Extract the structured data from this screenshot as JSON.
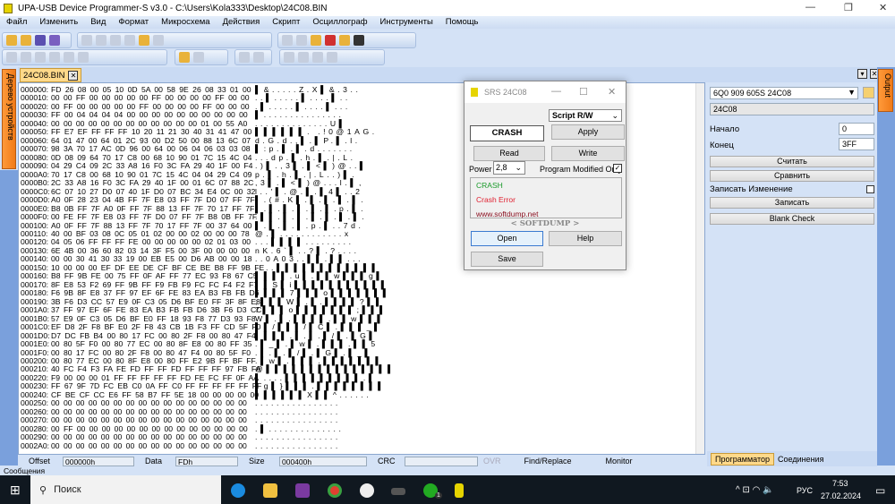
{
  "window": {
    "title": "UPA-USB Device Programmer-S v3.0 - C:\\Users\\Kola333\\Desktop\\24C08.BIN",
    "min": "—",
    "max": "❐",
    "close": "✕"
  },
  "menu": [
    "Файл",
    "Изменить",
    "Вид",
    "Формат",
    "Микросхема",
    "Действия",
    "Скрипт",
    "Осциллограф",
    "Инструменты",
    "Помощь"
  ],
  "file_tab": "24C08.BIN",
  "left_tab": "Дерево устройств",
  "right_tab": "Output",
  "hex_rows": [
    [
      "000000:",
      "FD 26 08 00 05 10 0D 5A 00 58 9E 26 08 33 01 00"
    ],
    [
      "000010:",
      "00 00 FF 00 00 00 00 00 FF 00 00 00 00 FF 00 00"
    ],
    [
      "000020:",
      "00 FF 00 00 00 00 00 FF 00 00 00 00 FF 00 00 00"
    ],
    [
      "000030:",
      "FF 00 04 04 04 04 00 00 00 00 00 00 00 00 00 00"
    ],
    [
      "000040:",
      "00 00 00 00 00 00 00 00 00 00 00 00 01 00 55 A0"
    ],
    [
      "000050:",
      "FF E7 EF FF FF FF 10 20 11 21 30 40 31 41 47 00"
    ],
    [
      "000060:",
      "64 01 47 00 64 01 2C 93 00 D2 50 00 88 13 6C 07"
    ],
    [
      "000070:",
      "98 3A 70 17 AC 0D 96 00 64 00 06 04 06 03 03 08"
    ],
    [
      "000080:",
      "0D 08 09 64 70 17 C8 00 68 10 90 01 7C 15 4C 04"
    ],
    [
      "000090:",
      "04 29 C4 09 2C 33 A8 16 F0 3C FA 29 40 1F 00 F4"
    ],
    [
      "0000A0:",
      "70 17 C8 00 68 10 90 01 7C 15 4C 04 04 29 C4 09"
    ],
    [
      "0000B0:",
      "2C 33 A8 16 F0 3C FA 29 40 1F 00 01 6C 07 88 2C"
    ],
    [
      "0000C0:",
      "6C 07 10 27 D0 07 40 1F D0 07 BC 34 E4 0C 00 32"
    ],
    [
      "0000D0:",
      "A0 0F 28 23 04 4B FF 7F E8 03 FF 7F D0 07 FF 7F"
    ],
    [
      "0000E0:",
      "B8 0B FF 7F A0 0F FF 7F 88 13 FF 7F 70 17 FF 7F"
    ],
    [
      "0000F0:",
      "00 FE FF 7F E8 03 FF 7F D0 07 FF 7F B8 0B FF 7F"
    ],
    [
      "000100:",
      "A0 0F FF 7F 88 13 FF 7F 70 17 FF 7F 00 37 64 00"
    ],
    [
      "000110:",
      "40 00 BF 03 08 0C 05 01 02 00 00 02 00 00 00 78"
    ],
    [
      "000120:",
      "04 05 06 FF FF FF FE 00 00 00 00 00 02 01 03 00"
    ],
    [
      "000130:",
      "6E 4B 00 36 60 82 03 14 3F F5 00 3F 00 00 00 00"
    ],
    [
      "000140:",
      "00 00 30 41 30 33 19 00 EB E5 00 D6 AB 00 00 18"
    ],
    [
      "000150:",
      "10 00 00 00 EF DF EE DE CF BF CE BE B8 FF 9B FE"
    ],
    [
      "000160:",
      "B8 FF 9B FE 00 75 FF 0F AF FF 77 EC 93 F8 67 C5"
    ],
    [
      "000170:",
      "8F E8 53 F2 69 FF 9B FF F9 FB F9 FC FC F4 F2 F7"
    ],
    [
      "000180:",
      "F6 9B 8F E8 37 FF 97 EF 6F FE 83 EA B3 FB FB D6"
    ],
    [
      "000190:",
      "3B F6 D3 CC 57 E9 0F C3 05 D6 BF E0 FF 3F 8F E8"
    ],
    [
      "0001A0:",
      "37 FF 97 EF 6F FE 83 EA B3 FB FB D6 3B F6 D3 CC"
    ],
    [
      "0001B0:",
      "57 E9 0F C3 05 D6 BF E0 FF 18 93 F8 77 D3 93 F8"
    ],
    [
      "0001C0:",
      "EF D8 2F F8 BF E0 2F F8 43 CB 1B F3 FF CD 5F F0"
    ],
    [
      "0001D0:",
      "D7 DC FB B4 00 80 17 FC 00 80 2F F8 00 80 47 F4"
    ],
    [
      "0001E0:",
      "00 80 5F F0 00 80 77 EC 00 80 8F E8 00 80 FF 35"
    ],
    [
      "0001F0:",
      "00 80 17 FC 00 80 2F F8 00 80 47 F4 00 80 5F F0"
    ],
    [
      "000200:",
      "00 80 77 EC 00 80 8F E8 00 80 FF E2 9B FF BF FF"
    ],
    [
      "000210:",
      "40 FC F4 F3 FA FE FD FF FF FD FF FF FF 97 FB FA"
    ],
    [
      "000220:",
      "F9 00 00 00 01 FF FF FF FF FF FD FE FC FF 0F AA"
    ],
    [
      "000230:",
      "FF 67 9F 7D FC EB C0 0A FF C0 FF FF FF FF FF FF"
    ],
    [
      "000240:",
      "CF BE CF CC E6 FF 58 B7 FF 5E 18 00 00 00 00 00"
    ],
    [
      "000250:",
      "00 00 00 00 00 00 00 00 00 00 00 00 00 00 00 00"
    ],
    [
      "000260:",
      "00 00 00 00 00 00 00 00 00 00 00 00 00 00 00 00"
    ],
    [
      "000270:",
      "00 00 00 00 00 00 00 00 00 00 00 00 00 00 00 00"
    ],
    [
      "000280:",
      "00 FF 00 00 00 00 00 00 00 00 00 00 00 00 00 00"
    ],
    [
      "000290:",
      "00 00 00 00 00 00 00 00 00 00 00 00 00 00 00 00"
    ],
    [
      "0002A0:",
      "00 00 00 00 00 00 00 00 00 00 00 00 00 00 00 00"
    ]
  ],
  "status": {
    "offset_label": "Offset",
    "offset": "000000h",
    "data_label": "Data",
    "data": "FDh",
    "size_label": "Size",
    "size": "000400h",
    "crc_label": "CRC",
    "crc": "",
    "ovr": "OVR",
    "find": "Find/Replace",
    "monitor": "Monitor"
  },
  "right_panel": {
    "device": "6Q0 909 605S 24C08",
    "chip": "24C08",
    "start_label": "Начало",
    "start": "0",
    "end_label": "Конец",
    "end": "3FF",
    "read": "Считать",
    "compare": "Сравнить",
    "write_changes": "Записать Изменение",
    "write_changes_checked": false,
    "write": "Записать",
    "blank": "Blank Check",
    "tabs": [
      "Программатор",
      "Соединения"
    ]
  },
  "messages_label": "Сообщения",
  "dialog": {
    "title": "SRS 24C08",
    "script": "Script R/W",
    "display": "CRASH",
    "apply": "Apply",
    "read": "Read",
    "write": "Write",
    "power_label": "Power",
    "power": "2,8",
    "pmo": "Program Modified Only",
    "pmo_checked": true,
    "log": [
      "CRASH",
      "Crash Error",
      "www.softdump.net"
    ],
    "brand": "< SOFTDUMP >",
    "open": "Open",
    "help": "Help",
    "save": "Save"
  },
  "taskbar": {
    "search": "Поиск",
    "badge": "1",
    "lang": "РУС",
    "time": "7:53",
    "date": "27.02.2024"
  },
  "colors": {
    "accent": "#f07a18",
    "log_green": "#1a9a2a",
    "log_red": "#e02030",
    "log_dark": "#8a1020"
  }
}
